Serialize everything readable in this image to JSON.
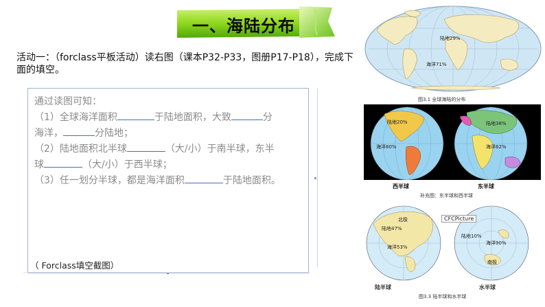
{
  "title": "一、海陆分布",
  "activity_text": "活动一：（forclass平板活动）读右图（课本P32-P33，图册P17-P18），完成下面的填空。",
  "answer_box": {
    "intro": "通过读图可知：",
    "q1a": "（1）全球海洋面积",
    "q1b": "于陆地面积，大致",
    "q1c": "分",
    "q1d": "海洋，",
    "q1e": "分陆地；",
    "q2a": "（2）陆地面积北半球",
    "q2b": "（大/小）于南半球，东半",
    "q2c": "球",
    "q2d": "（大/小）于西半球；",
    "q3a": "（3）任一划分半球，都是海洋面积",
    "q3b": "于陆地面积。"
  },
  "caption": "（ Forclass填空截图）",
  "fig1": {
    "land_label": "陆地29%",
    "ocean_label": "海洋71%",
    "caption": "图3.1  全球海陆的分布"
  },
  "fig2": {
    "west_land": "陆地20%",
    "west_ocean": "海洋80%",
    "east_land": "陆地38%",
    "east_ocean": "海洋62%",
    "west_name": "西半球",
    "east_name": "东半球",
    "caption": "补充图：东半球和西半球"
  },
  "fig3": {
    "north": "北极",
    "land_land": "陆地47%",
    "land_ocean": "海洋53%",
    "water_land": "陆地10%",
    "water_ocean": "海洋90%",
    "south": "南极",
    "land_name": "陆半球",
    "water_name": "水半球",
    "caption": "图3.3  陆半球和水半球",
    "overlay": "CFCPicture"
  }
}
